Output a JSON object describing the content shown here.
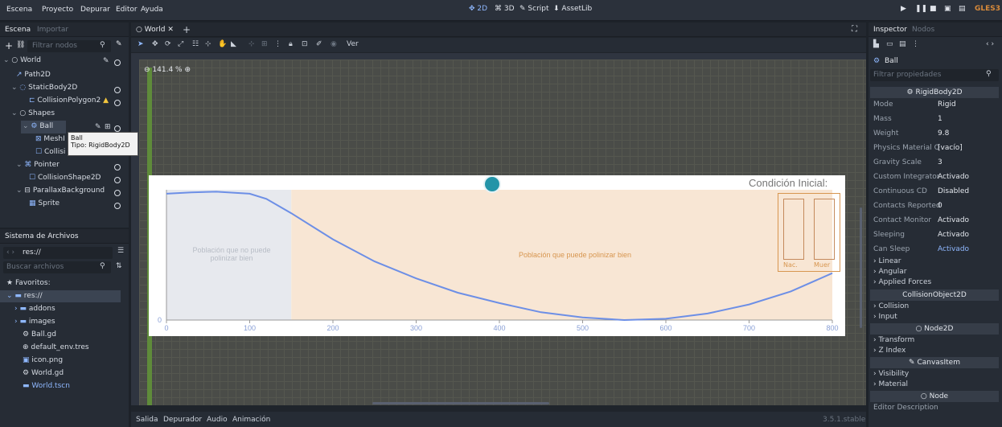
{
  "menu": [
    "Escena",
    "Proyecto",
    "Depurar",
    "Editor",
    "Ayuda"
  ],
  "switcher": [
    "2D",
    "3D",
    "Script",
    "AssetLib"
  ],
  "renderer": "GLES3",
  "scene_dock": {
    "tabs": [
      "Escena",
      "Importar"
    ],
    "filter_placeholder": "Filtrar nodos",
    "tree": [
      {
        "label": "World",
        "indent": 0
      },
      {
        "label": "Path2D",
        "indent": 1
      },
      {
        "label": "StaticBody2D",
        "indent": 1
      },
      {
        "label": "CollisionPolygon2",
        "indent": 2
      },
      {
        "label": "Shapes",
        "indent": 1
      },
      {
        "label": "Ball",
        "indent": 1
      },
      {
        "label": "MeshI",
        "indent": 2
      },
      {
        "label": "Collisi",
        "indent": 2
      },
      {
        "label": "Pointer",
        "indent": 1
      },
      {
        "label": "CollisionShape2D",
        "indent": 2
      },
      {
        "label": "ParallaxBackground",
        "indent": 1
      },
      {
        "label": "Sprite",
        "indent": 2
      }
    ],
    "tooltip_line1": "Ball",
    "tooltip_line2": "Tipo: RigidBody2D"
  },
  "filesystem": {
    "title": "Sistema de Archivos",
    "path": "res://",
    "search_placeholder": "Buscar archivos",
    "items": [
      "Favoritos:",
      "res://",
      "addons",
      "images",
      "Ball.gd",
      "default_env.tres",
      "icon.png",
      "World.gd",
      "World.tscn"
    ]
  },
  "editor": {
    "tab": "World",
    "view_menu": "Ver",
    "zoom": "141.4 %",
    "bottom_tabs": [
      "Salida",
      "Depurador",
      "Audio",
      "Animación"
    ],
    "version": "3.5.1.stable"
  },
  "chart_data": {
    "type": "line",
    "title": "Condición Inicial:",
    "x_ticks": [
      0,
      100,
      200,
      300,
      400,
      500,
      600,
      700,
      800
    ],
    "y_ticks": [
      0
    ],
    "xlim": [
      0,
      800
    ],
    "regions": [
      {
        "label": "Población que no puede polinizar bien",
        "from": 0,
        "to": 150,
        "color": "#e7e9ee"
      },
      {
        "label": "Población que puede polinizar bien",
        "from": 150,
        "to": 800,
        "color": "#f8e6d4"
      }
    ],
    "series": [
      {
        "x": [
          0,
          30,
          60,
          100,
          120,
          150,
          200,
          250,
          300,
          350,
          400,
          450,
          500,
          550,
          600,
          650,
          700,
          750,
          800
        ],
        "y": [
          0.97,
          0.98,
          0.985,
          0.97,
          0.93,
          0.82,
          0.62,
          0.45,
          0.32,
          0.21,
          0.13,
          0.06,
          0.02,
          0.0,
          0.01,
          0.05,
          0.12,
          0.22,
          0.36
        ]
      }
    ],
    "mini_bars_labels": [
      "Nac.",
      "Muer"
    ]
  },
  "inspector": {
    "tabs": [
      "Inspector",
      "Nodos"
    ],
    "node": "Ball",
    "filter_placeholder": "Filtrar propiedades",
    "class1": "RigidBody2D",
    "props": [
      {
        "name": "Mode",
        "value": "Rigid"
      },
      {
        "name": "Mass",
        "value": "1"
      },
      {
        "name": "Weight",
        "value": "9.8"
      },
      {
        "name": "Physics Material O",
        "value": "[vacío]"
      },
      {
        "name": "Gravity Scale",
        "value": "3"
      },
      {
        "name": "Custom Integrator",
        "value": "Activado"
      },
      {
        "name": "Continuous CD",
        "value": "Disabled"
      },
      {
        "name": "Contacts Reported",
        "value": "0"
      },
      {
        "name": "Contact Monitor",
        "value": "Activado"
      },
      {
        "name": "Sleeping",
        "value": "Activado"
      },
      {
        "name": "Can Sleep",
        "value": "Activado"
      }
    ],
    "groups1": [
      "Linear",
      "Angular",
      "Applied Forces"
    ],
    "class2": "CollisionObject2D",
    "groups2": [
      "Collision",
      "Input"
    ],
    "class3": "Node2D",
    "groups3": [
      "Transform",
      "Z Index"
    ],
    "class4": "CanvasItem",
    "groups4": [
      "Visibility",
      "Material"
    ],
    "class5": "Node",
    "editor_description": "Editor Description"
  }
}
